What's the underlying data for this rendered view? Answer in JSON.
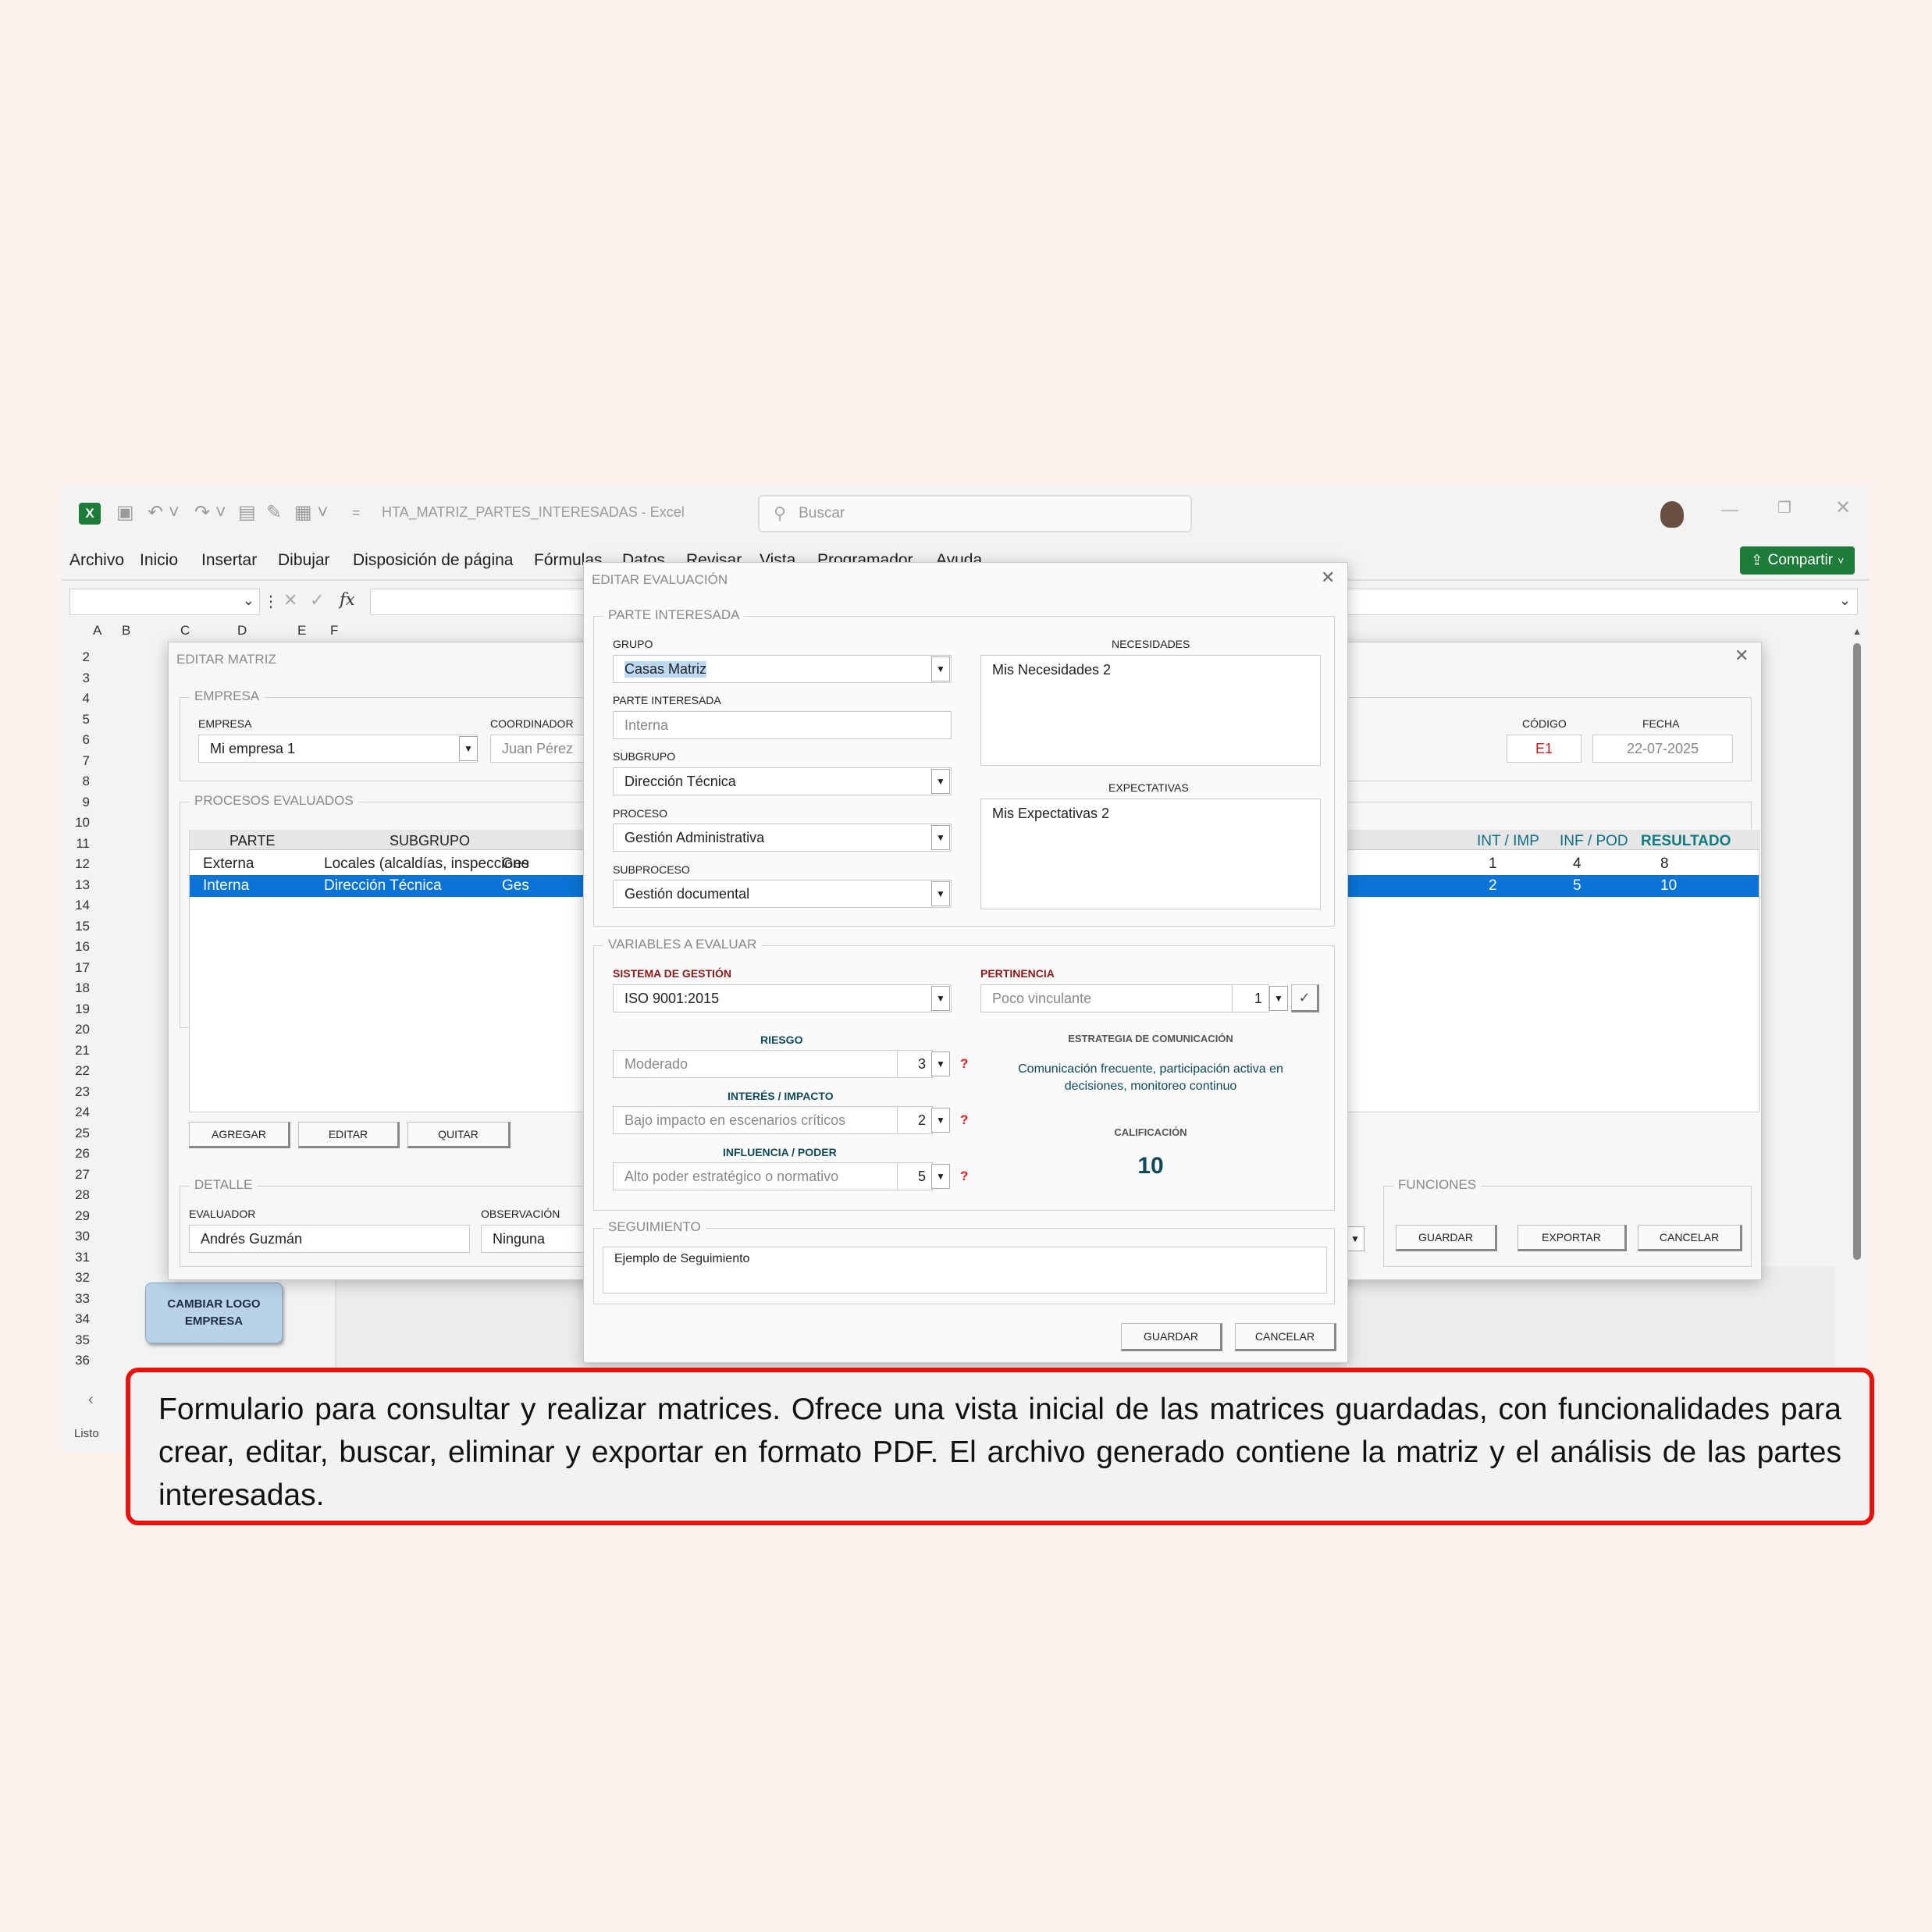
{
  "excel": {
    "file_title": "HTA_MATRIZ_PARTES_INTERESADAS",
    "app_name": "Excel",
    "search_placeholder": "Buscar",
    "share_label": "Compartir",
    "menu": [
      "Archivo",
      "Inicio",
      "Insertar",
      "Dibujar",
      "Disposición de página",
      "Fórmulas",
      "Datos",
      "Revisar",
      "Vista",
      "Programador",
      "Ayuda"
    ],
    "fx_label": "fx",
    "columns": [
      "A",
      "B",
      "C",
      "D",
      "E",
      "F"
    ],
    "rows": [
      "2",
      "3",
      "4",
      "5",
      "6",
      "7",
      "8",
      "9",
      "10",
      "11",
      "12",
      "13",
      "14",
      "15",
      "16",
      "17",
      "18",
      "19",
      "20",
      "21",
      "22",
      "23",
      "24",
      "25",
      "26",
      "27",
      "28",
      "29",
      "30",
      "31",
      "32",
      "33",
      "34",
      "35",
      "36"
    ],
    "status": "Listo",
    "change_logo_button": "CAMBIAR LOGO EMPRESA",
    "sidebar_icons": [
      "building-icon",
      "gears-icon",
      "people-icon",
      "org-hierarchy-icon",
      "process-chain-icon",
      "flowchart-icon",
      "stars-icon",
      "certificate-icon"
    ]
  },
  "matrix_dialog": {
    "title": "EDITAR MATRIZ",
    "empresa_frame": "EMPRESA",
    "empresa_label": "EMPRESA",
    "empresa_value": "Mi empresa 1",
    "coordinador_label": "COORDINADOR",
    "coordinador_value": "Juan Pérez",
    "codigo_label": "CÓDIGO",
    "codigo_value": "E1",
    "fecha_label": "FECHA",
    "fecha_value": "22-07-2025",
    "procesos_frame": "PROCESOS EVALUADOS",
    "table_headers": [
      "PARTE",
      "SUBGRUPO",
      "INT / IMP",
      "INF / POD",
      "RESULTADO"
    ],
    "rows": [
      {
        "parte": "Externa",
        "subgrupo": "Locales (alcaldías, inspeccione",
        "proc": "Ges",
        "int": "1",
        "inf": "4",
        "res": "8"
      },
      {
        "parte": "Interna",
        "subgrupo": "Dirección Técnica",
        "proc": "Ges",
        "int": "2",
        "inf": "5",
        "res": "10"
      }
    ],
    "add_button": "AGREGAR",
    "edit_button": "EDITAR",
    "remove_button": "QUITAR",
    "detalle_frame": "DETALLE",
    "evaluador_label": "EVALUADOR",
    "evaluador_value": "Andrés Guzmán",
    "observacion_label": "OBSERVACIÓN",
    "observacion_value": "Ninguna",
    "funciones_frame": "FUNCIONES",
    "save_button": "GUARDAR",
    "export_button": "EXPORTAR",
    "cancel_button": "CANCELAR"
  },
  "eval_dialog": {
    "title": "EDITAR EVALUACIÓN",
    "parte_frame": "PARTE INTERESADA",
    "grupo_label": "GRUPO",
    "grupo_value": "Casas Matriz",
    "parte_label": "PARTE INTERESADA",
    "parte_value": "Interna",
    "subgrupo_label": "SUBGRUPO",
    "subgrupo_value": "Dirección Técnica",
    "proceso_label": "PROCESO",
    "proceso_value": "Gestión Administrativa",
    "subproceso_label": "SUBPROCESO",
    "subproceso_value": "Gestión documental",
    "necesidades_label": "NECESIDADES",
    "necesidades_value": "Mis Necesidades 2",
    "expectativas_label": "EXPECTATIVAS",
    "expectativas_value": "Mis Expectativas 2",
    "variables_frame": "VARIABLES A EVALUAR",
    "sistema_label": "SISTEMA DE GESTIÓN",
    "sistema_value": "ISO 9001:2015",
    "pertinencia_label": "PERTINENCIA",
    "pertinencia_value": "Poco vinculante",
    "pertinencia_num": "1",
    "check_mark": "✓",
    "riesgo_label": "RIESGO",
    "riesgo_value": "Moderado",
    "riesgo_num": "3",
    "interes_label": "INTERÉS / IMPACTO",
    "interes_value": "Bajo impacto en escenarios críticos",
    "interes_num": "2",
    "influencia_label": "INFLUENCIA / PODER",
    "influencia_value": "Alto poder estratégico o normativo",
    "influencia_num": "5",
    "help_mark": "?",
    "estrategia_label": "ESTRATEGIA DE COMUNICACIÓN",
    "estrategia_value": "Comunicación frecuente, participación activa en decisiones, monitoreo continuo",
    "calificacion_label": "CALIFICACIÓN",
    "calificacion_value": "10",
    "seguimiento_frame": "SEGUIMIENTO",
    "seguimiento_value": "Ejemplo de Seguimiento",
    "save_button": "GUARDAR",
    "cancel_button": "CANCELAR"
  },
  "caption": "Formulario para consultar y realizar matrices. Ofrece una vista inicial de las matrices guardadas, con funcionalidades para crear, editar, buscar, eliminar y exportar en formato PDF. El archivo generado contiene la matriz y el análisis de las partes interesadas.",
  "colors": {
    "accent_blue": "#0a74d6",
    "share_green": "#1e7c3b",
    "caption_border": "#e8140c",
    "teal": "#0f7c80"
  }
}
